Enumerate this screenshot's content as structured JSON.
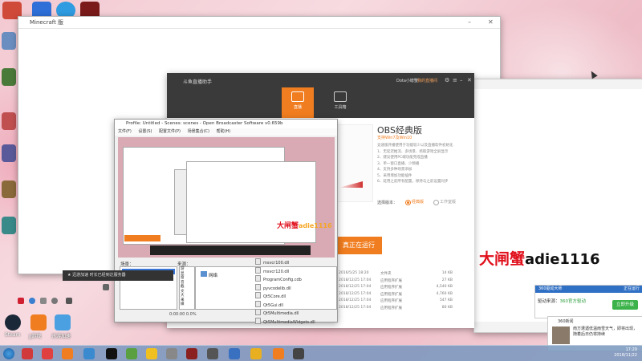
{
  "desktop": {
    "icon_labels": [
      "Steam",
      "JJ游戏",
      "迅游加速"
    ]
  },
  "minecraft": {
    "title": "Minecraft 版"
  },
  "douyu": {
    "title": "斗鱼直播助手",
    "user": "Dota小螃蟹",
    "link": "我的直播间",
    "tabs": [
      {
        "label": "直播"
      },
      {
        "label": "工具箱"
      }
    ],
    "obs_title": "OBS经典版",
    "obs_subtitle": "支持Win7及Win10",
    "obs_desc": [
      "竞速版开播使用于功能较少以及直播软件初始化",
      "1、无延迟推流、多场景、抓取游戏全屏显示",
      "2、建议使用PC端功能完成直播",
      "3、单一窗口直播、少频播",
      "4、支持多种场景添加",
      "5、采用增加功能插件",
      "6、延用之前所有配置，保持与之前设置同步"
    ],
    "version_label": "选择版本：",
    "version_options": [
      "经典版",
      "工作室版"
    ],
    "run_button": "真正在运行",
    "file_rows": [
      {
        "date": "2016/5/25 18:20",
        "type": "文件夹",
        "size": "14 KB"
      },
      {
        "date": "2018/12/25 17:04",
        "type": "应用程序扩展",
        "size": "27 KB"
      },
      {
        "date": "2018/12/25 17:04",
        "type": "应用程序扩展",
        "size": "4,540 KB"
      },
      {
        "date": "2018/12/25 17:04",
        "type": "应用程序扩展",
        "size": "4,760 KB"
      },
      {
        "date": "2018/12/25 17:04",
        "type": "应用程序扩展",
        "size": "547 KB"
      },
      {
        "date": "2018/12/25 17:04",
        "type": "应用程序扩展",
        "size": "80 KB"
      }
    ]
  },
  "obs": {
    "title": "Profile: Untitled - Scenes: scenes - Open Broadcaster Software v0.659b",
    "menu": [
      "文件(F)",
      "设置(S)",
      "配置文件(P)",
      "场景集合(C)",
      "帮助(H)"
    ],
    "scenes_label": "场景：",
    "sources_label": "来源：",
    "sources_items": [
      "游",
      "显",
      "窗",
      "音",
      "截",
      "文",
      "大",
      "来",
      "媒"
    ],
    "footer": "0:00:00  0.0%"
  },
  "explorer": {
    "network_label": "网络",
    "files": [
      "msvcr100.dll",
      "msvcr120.dll",
      "ProgramConfig.cdb",
      "pyvcodelib.dll",
      "Qt5Core.dll",
      "Qt5Gui.dll",
      "Qt5Multimedia.dll",
      "Qt5MultimediaWidgets.dll"
    ]
  },
  "watermark": {
    "cn": "大闸蟹",
    "latin": "adie1116"
  },
  "mini_watermark": {
    "cn": "大闸蟹",
    "latin": "adie1116"
  },
  "dark_bar": {
    "text": "★ 迅游加速 时长已经到达服务器"
  },
  "popup_360": {
    "header": "360驱动大师",
    "header_right": "正在运行",
    "body_prefix": "驱动来源：",
    "body_highlight": "360官方驱动",
    "button": "立即升级"
  },
  "popup_news": {
    "header": "360新闻",
    "text": "南方遭遇低温雨雪天气，即将出现，随着后日仍将持续"
  },
  "taskbar": {
    "time": "17:29",
    "date": "2018/11/22"
  },
  "colors": {
    "accent": "#f07d1f",
    "douyu_header": "#3a3a3a",
    "watermark_red": "#e0101c"
  }
}
